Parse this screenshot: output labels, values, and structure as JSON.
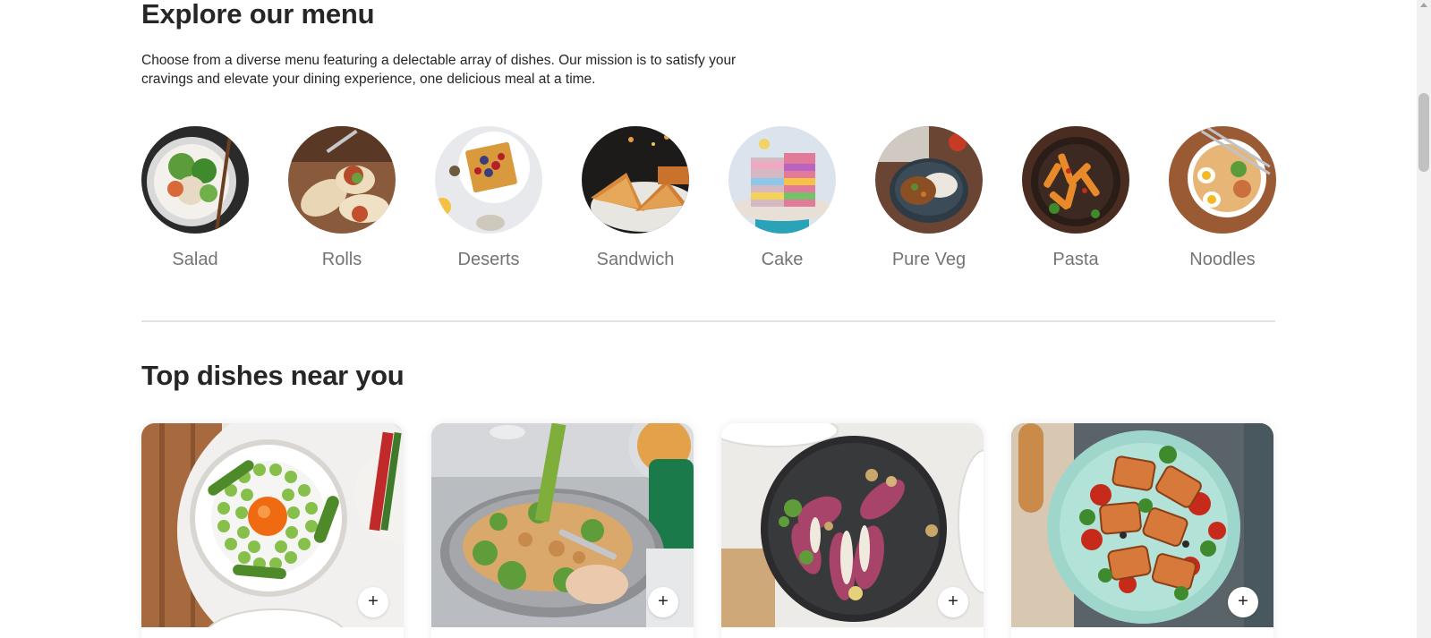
{
  "explore": {
    "title": "Explore our menu",
    "description": "Choose from a diverse menu featuring a delectable array of dishes. Our mission is to satisfy your cravings and elevate your dining experience, one delicious meal at a time."
  },
  "menu": {
    "items": [
      {
        "label": "Salad"
      },
      {
        "label": "Rolls"
      },
      {
        "label": "Deserts"
      },
      {
        "label": "Sandwich"
      },
      {
        "label": "Cake"
      },
      {
        "label": "Pure Veg"
      },
      {
        "label": "Pasta"
      },
      {
        "label": "Noodles"
      }
    ]
  },
  "top_dishes": {
    "title": "Top dishes near you",
    "add_label": "+"
  },
  "colors": {
    "heading": "#262626",
    "menu_label": "#747474",
    "divider": "#e2e2e2"
  }
}
